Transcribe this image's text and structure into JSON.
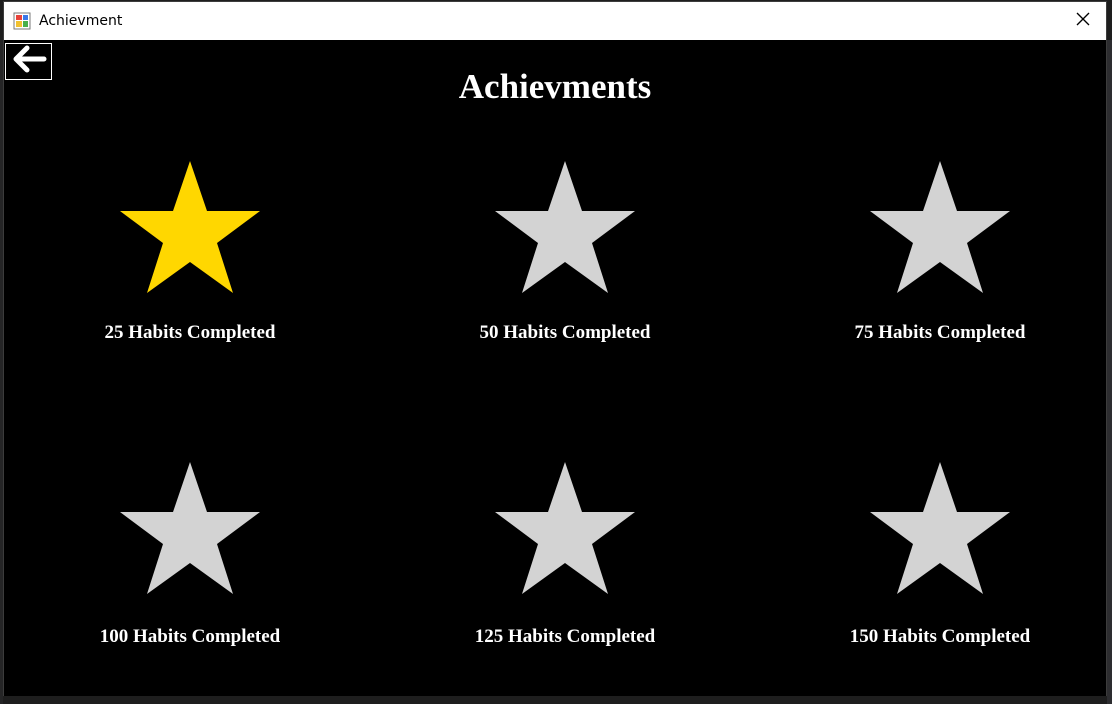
{
  "window": {
    "title": "Achievment",
    "app_icon": "winforms-app-icon",
    "close_icon": "close-icon"
  },
  "page": {
    "title": "Achievments",
    "back_icon": "back-arrow-icon"
  },
  "colors": {
    "earned": "#FFD700",
    "locked": "#D3D3D3",
    "background": "#000000",
    "text": "#FFFFFF"
  },
  "achievements": [
    {
      "label": "25 Habits Completed",
      "earned": true
    },
    {
      "label": "50 Habits Completed",
      "earned": false
    },
    {
      "label": "75 Habits Completed",
      "earned": false
    },
    {
      "label": "100 Habits Completed",
      "earned": false
    },
    {
      "label": "125 Habits Completed",
      "earned": false
    },
    {
      "label": "150 Habits Completed",
      "earned": false
    }
  ]
}
